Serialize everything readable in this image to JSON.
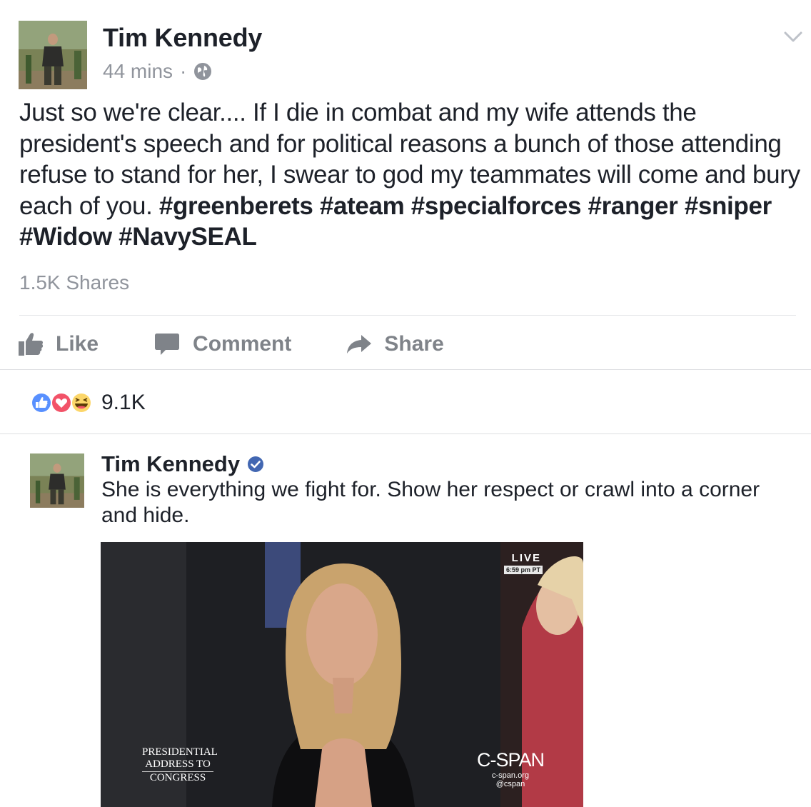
{
  "post": {
    "author": "Tim Kennedy",
    "time": "44 mins",
    "separator": "·",
    "icons": {
      "privacy": "globe-icon",
      "menu": "chevron-down-icon"
    },
    "text": "Just so we're clear.... If I die in combat and my wife attends the president's speech and for political reasons a bunch of those attending refuse to stand for her, I swear to god my teammates will come and bury each of you.",
    "hashtags": "#greenberets #ateam #specialforces #ranger #sniper #Widow #NavySEAL",
    "shares": "1.5K Shares"
  },
  "actions": {
    "like": "Like",
    "comment": "Comment",
    "share": "Share"
  },
  "reactions": {
    "count": "9.1K",
    "types": [
      "like-reaction-icon",
      "love-reaction-icon",
      "haha-reaction-icon"
    ],
    "colors": {
      "like": "#5890ff",
      "love": "#f25268",
      "haha": "#fcd669"
    }
  },
  "shared_post": {
    "author": "Tim Kennedy",
    "verified": true,
    "text": "She is everything we fight for. Show her respect or crawl into a corner and hide.",
    "video": {
      "live_label": "LIVE",
      "live_time": "6:59 pm PT",
      "caption_line1": "PRESIDENTIAL",
      "caption_line2": "ADDRESS TO",
      "caption_line3": "CONGRESS",
      "network": "C-SPAN",
      "network_url": "c-span.org",
      "network_handle": "@cspan"
    }
  },
  "colors": {
    "text": "#1d2129",
    "meta": "#90949c",
    "verified_blue": "#4267b2",
    "action_gray": "#7f8389"
  }
}
